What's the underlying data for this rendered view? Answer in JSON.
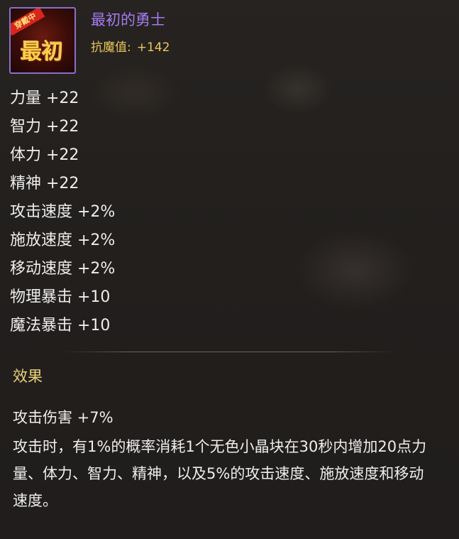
{
  "item": {
    "name": "最初的勇士",
    "icon_name": "first-warrior-title-icon",
    "icon_text": "最初",
    "icon_ribbon": "穿戴中",
    "resist_label": "抗魔值:",
    "resist_value": "+142"
  },
  "stats": [
    "力量 +22",
    "智力 +22",
    "体力 +22",
    "精神 +22",
    "攻击速度 +2%",
    "施放速度 +2%",
    "移动速度 +2%",
    "物理暴击 +10",
    "魔法暴击 +10"
  ],
  "effect": {
    "title": "效果",
    "bonus": "攻击伤害 +7%",
    "description": "攻击时，有1%的概率消耗1个无色小晶块在30秒内增加20点力量、体力、智力、精神，以及5%的攻击速度、施放速度和移动速度。"
  },
  "colors": {
    "name": "#a57bf0",
    "resist": "#e8c85a",
    "effect_title": "#ead27a",
    "text": "#eeeeee",
    "icon_border": "#8a6fc9"
  }
}
